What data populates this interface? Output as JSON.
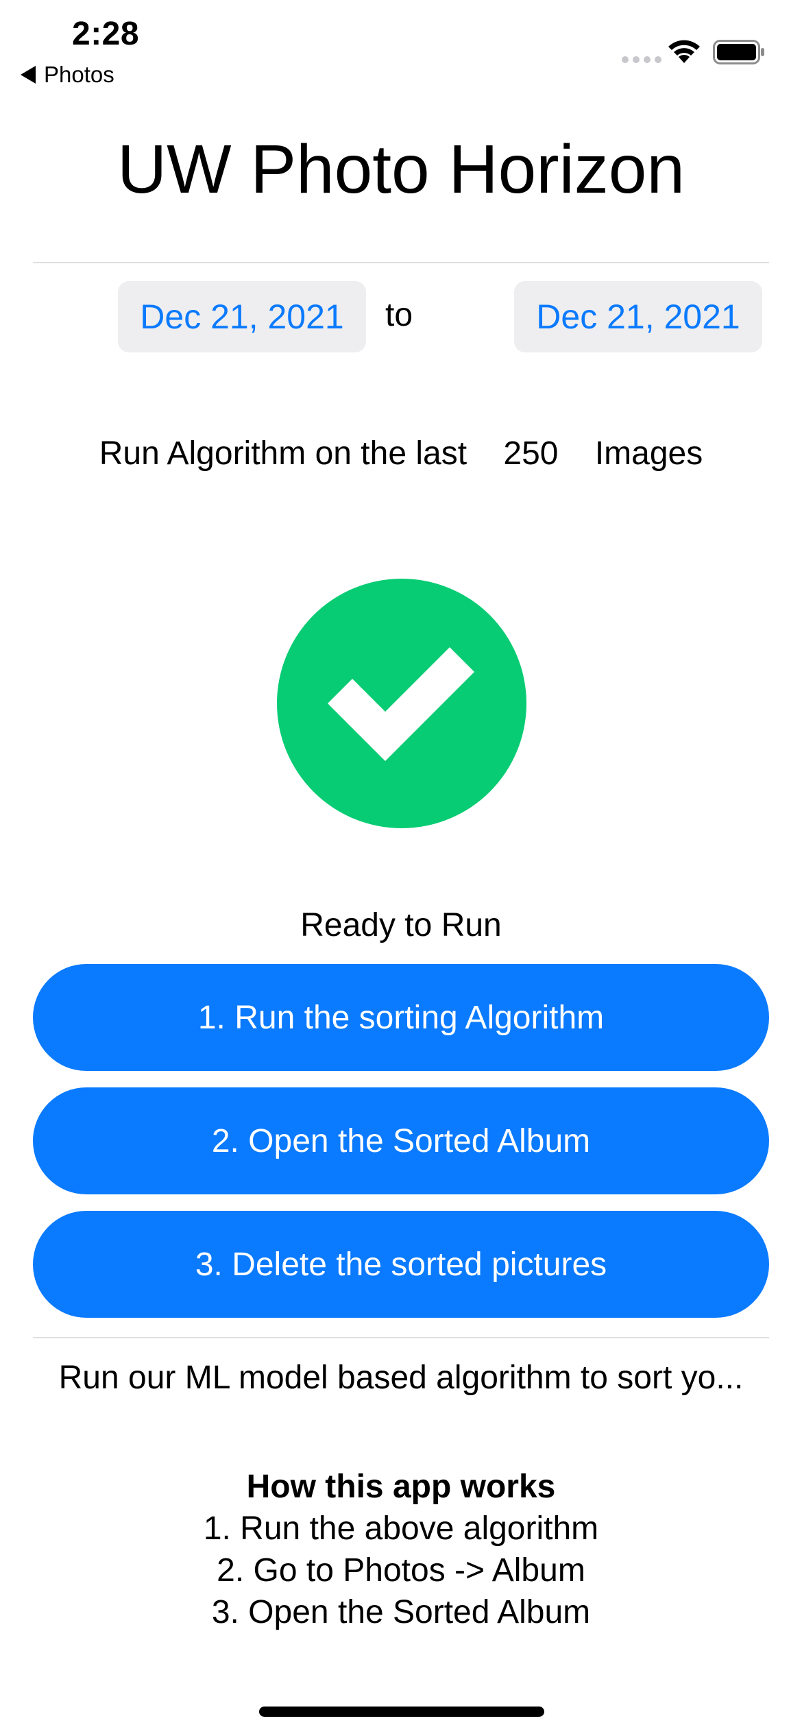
{
  "status_bar": {
    "time": "2:28",
    "back_label": "Photos"
  },
  "title": "UW Photo Horizon",
  "date_range": {
    "start": "Dec 21, 2021",
    "separator": "to",
    "end": "Dec 21, 2021"
  },
  "run_row": {
    "prefix": "Run Algorithm on the last",
    "count": "250",
    "suffix": "Images"
  },
  "status_icon": {
    "name": "checkmark-circle-icon",
    "color": "#07cc73"
  },
  "status_text": "Ready to Run",
  "buttons": [
    {
      "label": "1. Run the sorting Algorithm"
    },
    {
      "label": "2. Open the Sorted Album"
    },
    {
      "label": "3. Delete the sorted pictures"
    }
  ],
  "description": "Run our ML model based algorithm to sort yo...",
  "how_it_works": {
    "title": "How this app works",
    "steps": [
      "1. Run the above algorithm",
      "2. Go to Photos -> Album",
      "3. Open the Sorted Album"
    ]
  },
  "colors": {
    "accent": "#0a7aff",
    "success": "#07cc73",
    "date_bg": "#eeeef0"
  }
}
